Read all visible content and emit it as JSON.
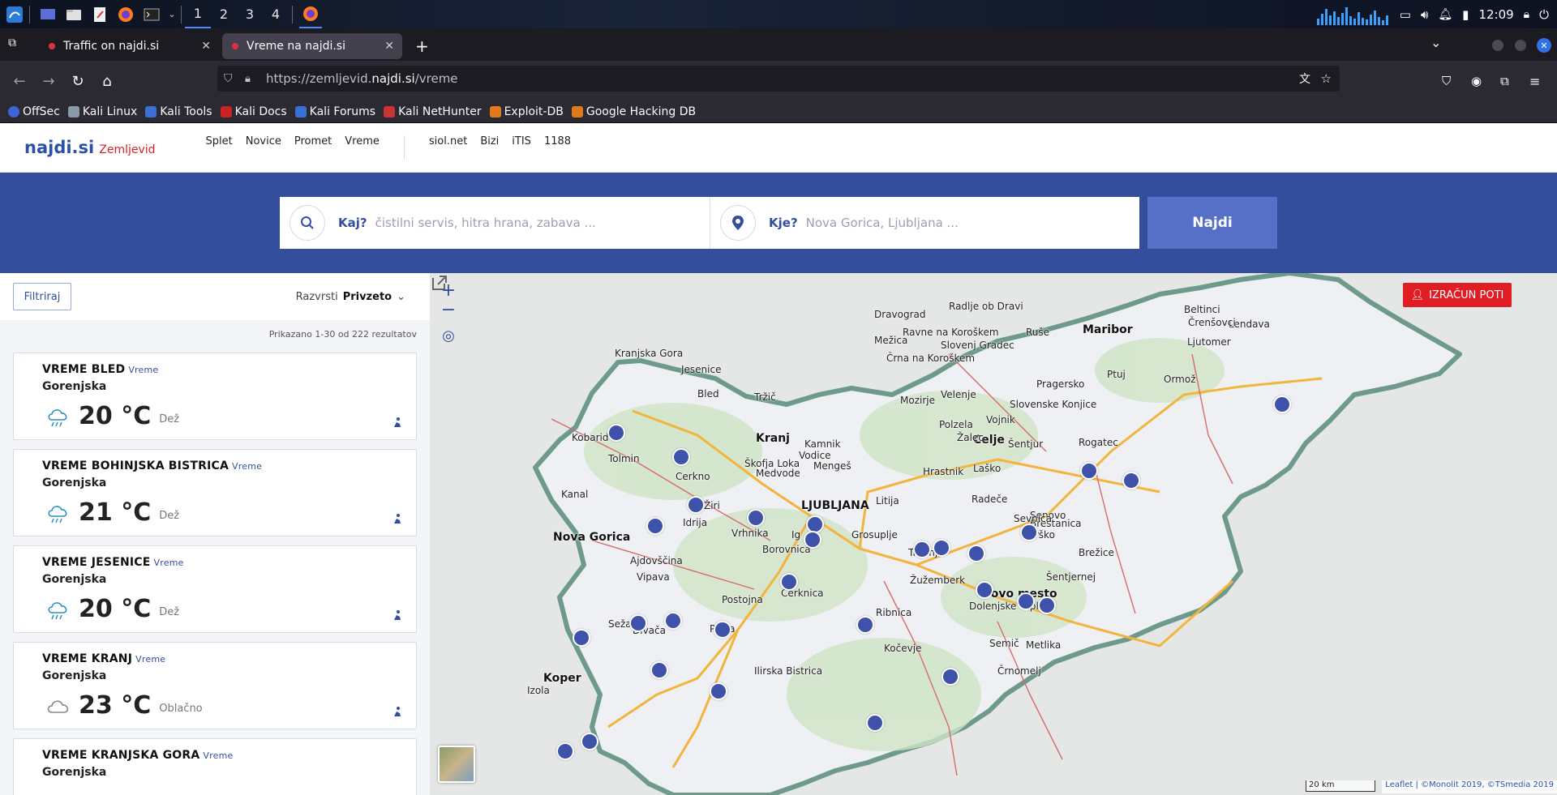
{
  "taskbar": {
    "workspaces": [
      "1",
      "2",
      "3",
      "4"
    ],
    "active_workspace": "1",
    "clock": "12:09"
  },
  "browser": {
    "tabs": [
      {
        "label": "Traffic on najdi.si",
        "active": false
      },
      {
        "label": "Vreme na najdi.si",
        "active": true
      }
    ],
    "url_prefix": "https://zemljevid.",
    "url_domain": "najdi.si",
    "url_path": "/vreme",
    "bookmarks": [
      "OffSec",
      "Kali Linux",
      "Kali Tools",
      "Kali Docs",
      "Kali Forums",
      "Kali NetHunter",
      "Exploit-DB",
      "Google Hacking DB"
    ]
  },
  "site": {
    "logo": "najdi.si",
    "logo_sub": "Zemljevid",
    "nav_primary": [
      "Splet",
      "Novice",
      "Promet",
      "Vreme"
    ],
    "nav_secondary": [
      "siol.net",
      "Bizi",
      "iTIS",
      "1188"
    ]
  },
  "search": {
    "what_label": "Kaj?",
    "what_placeholder": "čistilni servis, hitra hrana, zabava ...",
    "where_label": "Kje?",
    "where_placeholder": "Nova Gorica, Ljubljana ...",
    "submit": "Najdi"
  },
  "results": {
    "filter_label": "Filtriraj",
    "sort_label": "Razvrsti",
    "sort_value": "Privzeto",
    "count_text": "Prikazano 1-30 od 222 rezultatov",
    "items": [
      {
        "title": "VREME BLED",
        "tag": "Vreme",
        "region": "Gorenjska",
        "temp": "20",
        "unit": "°C",
        "condition": "Dež",
        "icon": "rain-cloud-icon"
      },
      {
        "title": "VREME BOHINJSKA BISTRICA",
        "tag": "Vreme",
        "region": "Gorenjska",
        "temp": "21",
        "unit": "°C",
        "condition": "Dež",
        "icon": "rain-cloud-icon"
      },
      {
        "title": "VREME JESENICE",
        "tag": "Vreme",
        "region": "Gorenjska",
        "temp": "20",
        "unit": "°C",
        "condition": "Dež",
        "icon": "rain-cloud-icon"
      },
      {
        "title": "VREME KRANJ",
        "tag": "Vreme",
        "region": "Gorenjska",
        "temp": "23",
        "unit": "°C",
        "condition": "Oblačno",
        "icon": "cloud-icon"
      },
      {
        "title": "VREME KRANJSKA GORA",
        "tag": "Vreme",
        "region": "Gorenjska",
        "temp": "",
        "unit": "",
        "condition": "",
        "icon": ""
      }
    ]
  },
  "map": {
    "route_button": "IZRAČUN POTI",
    "scale": "20 km",
    "attribution_leaflet": "Leaflet",
    "attribution_rest": "| ©Monolit 2019, ©TSmedia 2019",
    "cities": [
      {
        "name": "LJUBLJANA",
        "big": true
      },
      {
        "name": "Maribor",
        "big": true
      },
      {
        "name": "Celje",
        "big": true
      },
      {
        "name": "Kranj",
        "big": true
      },
      {
        "name": "Nova Gorica",
        "big": true
      },
      {
        "name": "Novo mesto",
        "big": true
      },
      {
        "name": "Koper",
        "big": true
      },
      {
        "name": "Kobarid"
      },
      {
        "name": "Tolmin"
      },
      {
        "name": "Kanal"
      },
      {
        "name": "Cerkno"
      },
      {
        "name": "Žiri"
      },
      {
        "name": "Škofja Loka"
      },
      {
        "name": "Medvode"
      },
      {
        "name": "Vodice"
      },
      {
        "name": "Mengeš"
      },
      {
        "name": "Tržič"
      },
      {
        "name": "Litija"
      },
      {
        "name": "Vrhnika"
      },
      {
        "name": "Borovnica"
      },
      {
        "name": "Grosuplje"
      },
      {
        "name": "Trebnje"
      },
      {
        "name": "Žužemberk"
      },
      {
        "name": "Ribnica"
      },
      {
        "name": "Kočevje"
      },
      {
        "name": "Cerknica"
      },
      {
        "name": "Postojna"
      },
      {
        "name": "Vipava"
      },
      {
        "name": "Ajdovščina"
      },
      {
        "name": "Idrija"
      },
      {
        "name": "Sežana"
      },
      {
        "name": "Divača"
      },
      {
        "name": "Pivka"
      },
      {
        "name": "Ilirska Bistrica"
      },
      {
        "name": "Semič"
      },
      {
        "name": "Metlika"
      },
      {
        "name": "Črnomelj"
      },
      {
        "name": "Dolenjske Toplice"
      },
      {
        "name": "Šentjernej"
      },
      {
        "name": "Brežice"
      },
      {
        "name": "Krško"
      },
      {
        "name": "Senovo"
      },
      {
        "name": "Brestanica"
      },
      {
        "name": "Sevnica"
      },
      {
        "name": "Radeče"
      },
      {
        "name": "Hrastnik"
      },
      {
        "name": "Laško"
      },
      {
        "name": "Šentjur"
      },
      {
        "name": "Rogatec"
      },
      {
        "name": "Žalec"
      },
      {
        "name": "Vojnik"
      },
      {
        "name": "Polzela"
      },
      {
        "name": "Velenje"
      },
      {
        "name": "Mozirje"
      },
      {
        "name": "Slovenske Konjice"
      },
      {
        "name": "Pragersko"
      },
      {
        "name": "Ptuj"
      },
      {
        "name": "Ormož"
      },
      {
        "name": "Ljutomer"
      },
      {
        "name": "Lendava"
      },
      {
        "name": "Črenšovci"
      },
      {
        "name": "Beltinci"
      },
      {
        "name": "Ruše"
      },
      {
        "name": "Radlje ob Dravi"
      },
      {
        "name": "Dravograd"
      },
      {
        "name": "Ravne na Koroškem"
      },
      {
        "name": "Mežica"
      },
      {
        "name": "Slovenj Gradec"
      },
      {
        "name": "Črna na Koroškem"
      },
      {
        "name": "Kranjska Gora"
      },
      {
        "name": "Jesenice"
      },
      {
        "name": "Bled"
      },
      {
        "name": "Kamnik"
      },
      {
        "name": "Ig"
      },
      {
        "name": "Izola"
      }
    ]
  }
}
